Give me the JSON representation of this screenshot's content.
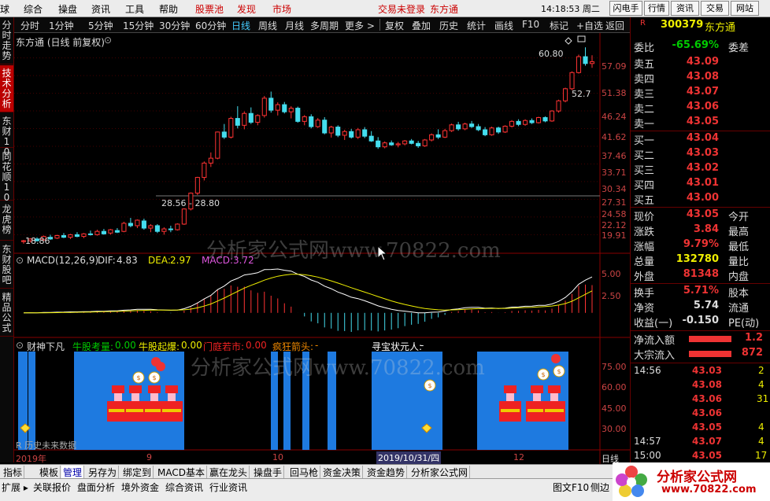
{
  "menubar": {
    "left_cut": "球",
    "items": [
      "综合",
      "操盘",
      "资讯",
      "工具",
      "帮助"
    ],
    "red_items": [
      "股票池",
      "发现",
      "市场"
    ],
    "status": "交易未登录",
    "broker": "东方通",
    "time": "14:18:53 周二",
    "buttons": [
      "闪电手",
      "行情",
      "资讯",
      "交易",
      "网站"
    ]
  },
  "left_tabs": [
    "分时走势",
    "技术分析",
    "东财10",
    "同花顺10",
    "龙虎榜",
    "东财股吧",
    "精品公式"
  ],
  "timeframes": [
    "分时",
    "1分钟",
    "5分钟",
    "15分钟",
    "30分钟",
    "60分钟",
    "日线",
    "周线",
    "月线",
    "多周期",
    "更多 >"
  ],
  "active_timeframe": "日线",
  "tools": [
    "复权",
    "叠加",
    "历史",
    "统计",
    "画线",
    "F10",
    "标记",
    "+自选",
    "返回"
  ],
  "chart_title": "东方通 (日线 前复权)",
  "price_axis": [
    "57.09",
    "51.38",
    "46.24",
    "41.62",
    "37.46",
    "33.71",
    "30.34",
    "27.31",
    "24.58",
    "22.12",
    "19.91"
  ],
  "annotations": {
    "high": "60.80",
    "level": "52.7",
    "range": "28.56 - 28.80",
    "low": "18.86"
  },
  "macd": {
    "name": "MACD(12,26,9)",
    "dif_label": "DIF:",
    "dif": "4.83",
    "dea_label": "DEA:",
    "dea": "2.97",
    "macd_label": "MACD:",
    "macd": "3.72",
    "axis": [
      "5.00",
      "2.50"
    ]
  },
  "ind3": {
    "name": "财神下凡",
    "items": [
      {
        "k": "牛股考量:",
        "v": "0.00",
        "c": "#0c0"
      },
      {
        "k": "牛股起爆:",
        "v": "0.00",
        "c": "#ff0"
      },
      {
        "k": "门庭若市:",
        "v": "0.00",
        "c": "#e22"
      },
      {
        "k": "疯狂箭头:",
        "v": "-",
        "c": "#e80"
      },
      {
        "k": "寻宝状元人:",
        "v": "-",
        "c": "#fff"
      }
    ],
    "axis": [
      "75.00",
      "60.00",
      "45.00",
      "30.00"
    ],
    "note": "R 历史未来数据"
  },
  "date_axis": {
    "labels": [
      "2019年",
      "9",
      "10",
      "2019/10/31/四",
      "12"
    ],
    "period": "日线"
  },
  "watermark": "分析家公式网www.70822.com",
  "quote": {
    "code": "300379",
    "name": "东方通",
    "code_prefix": "R",
    "wb_label": "委比",
    "wb": "-65.69%",
    "wc_label": "委差",
    "asks": [
      {
        "l": "卖五",
        "p": "43.09"
      },
      {
        "l": "卖四",
        "p": "43.08"
      },
      {
        "l": "卖三",
        "p": "43.07"
      },
      {
        "l": "卖二",
        "p": "43.06"
      },
      {
        "l": "卖一",
        "p": "43.05"
      }
    ],
    "bids": [
      {
        "l": "买一",
        "p": "43.04"
      },
      {
        "l": "买二",
        "p": "43.03"
      },
      {
        "l": "买三",
        "p": "43.02"
      },
      {
        "l": "买四",
        "p": "43.01"
      },
      {
        "l": "买五",
        "p": "43.00"
      }
    ],
    "stats": [
      {
        "l": "现价",
        "v": "43.05",
        "r": "今开"
      },
      {
        "l": "涨跌",
        "v": "3.84",
        "r": "最高"
      },
      {
        "l": "涨幅",
        "v": "9.79%",
        "r": "最低"
      },
      {
        "l": "总量",
        "v": "132780",
        "r": "量比"
      },
      {
        "l": "外盘",
        "v": "81348",
        "r": "内盘"
      }
    ],
    "stats2": [
      {
        "l": "换手",
        "v": "5.71%",
        "r": "股本"
      },
      {
        "l": "净资",
        "v": "5.74",
        "r": "流通"
      },
      {
        "l": "收益(一)",
        "v": "-0.150",
        "r": "PE(动)"
      }
    ],
    "flow": [
      {
        "l": "净流入额",
        "v": "1.2"
      },
      {
        "l": "大宗流入",
        "v": "872"
      }
    ],
    "ticks": [
      {
        "t": "14:56",
        "p": "43.03",
        "v": "2"
      },
      {
        "t": "",
        "p": "43.08",
        "v": "4"
      },
      {
        "t": "",
        "p": "43.06",
        "v": "31"
      },
      {
        "t": "",
        "p": "43.06",
        "v": ""
      },
      {
        "t": "",
        "p": "43.05",
        "v": "4"
      },
      {
        "t": "14:57",
        "p": "43.07",
        "v": "4"
      },
      {
        "t": "15:00",
        "p": "43.05",
        "v": "17"
      }
    ]
  },
  "bottom_tabs": [
    "指标",
    "模板",
    "管理",
    "另存为",
    "绑定到",
    "MACD基本",
    "赢在龙头",
    "操盘手",
    "回马枪",
    "资金决策",
    "资金趋势",
    "分析家公式网"
  ],
  "active_bottom_tab": "管理",
  "status_items": [
    "扩展 ▸",
    "关联报价",
    "盘面分析",
    "境外资金",
    "综合资讯",
    "行业资讯"
  ],
  "status_right": [
    "图文F10",
    "侧边"
  ],
  "logo": {
    "text": "分析家公式网",
    "url": "www.70822.com"
  },
  "chart_data": {
    "type": "candlestick",
    "ylim": [
      18.5,
      62
    ],
    "candles": [
      [
        19.1,
        19.3,
        18.86,
        19.2
      ],
      [
        19.2,
        19.5,
        19.0,
        19.4
      ],
      [
        19.4,
        19.6,
        19.1,
        19.2
      ],
      [
        19.3,
        19.8,
        19.2,
        19.7
      ],
      [
        19.6,
        19.9,
        19.3,
        19.4
      ],
      [
        19.5,
        19.9,
        19.4,
        19.8
      ],
      [
        19.8,
        20.1,
        19.5,
        19.6
      ],
      [
        19.6,
        20.0,
        19.4,
        19.9
      ],
      [
        19.9,
        20.2,
        19.6,
        19.7
      ],
      [
        19.7,
        20.1,
        19.5,
        20.0
      ],
      [
        20.0,
        20.4,
        19.8,
        19.9
      ],
      [
        19.9,
        20.5,
        19.8,
        20.3
      ],
      [
        20.3,
        20.6,
        19.9,
        20.0
      ],
      [
        20.1,
        20.6,
        19.9,
        20.5
      ],
      [
        20.4,
        20.7,
        20.1,
        20.2
      ],
      [
        20.3,
        21.5,
        20.2,
        21.3
      ],
      [
        21.3,
        22.0,
        20.8,
        21.0
      ],
      [
        21.0,
        21.8,
        20.7,
        21.7
      ],
      [
        21.6,
        21.9,
        20.5,
        20.7
      ],
      [
        20.7,
        21.2,
        20.2,
        21.0
      ],
      [
        21.0,
        21.2,
        20.1,
        20.3
      ],
      [
        20.3,
        20.8,
        19.9,
        20.6
      ],
      [
        20.6,
        21.0,
        20.2,
        20.5
      ],
      [
        20.5,
        21.3,
        20.4,
        21.2
      ],
      [
        21.2,
        23.3,
        21.1,
        23.2
      ],
      [
        23.2,
        25.6,
        23.0,
        25.5
      ],
      [
        25.5,
        28.1,
        25.2,
        28.0
      ],
      [
        28.0,
        30.8,
        27.5,
        30.5
      ],
      [
        30.5,
        32.5,
        29.8,
        31.4
      ],
      [
        31.4,
        36.8,
        31.2,
        36.7
      ],
      [
        36.7,
        38.5,
        35.2,
        35.6
      ],
      [
        35.6,
        40.2,
        35.3,
        39.8
      ],
      [
        39.8,
        42.8,
        37.5,
        38.2
      ],
      [
        38.2,
        41.5,
        37.3,
        41.0
      ],
      [
        41.0,
        42.5,
        38.5,
        38.9
      ],
      [
        38.9,
        40.8,
        38.2,
        40.5
      ],
      [
        40.5,
        45.5,
        40.0,
        44.9
      ],
      [
        44.9,
        46.7,
        41.2,
        41.8
      ],
      [
        41.8,
        43.8,
        40.5,
        43.2
      ],
      [
        43.2,
        43.9,
        41.0,
        41.4
      ],
      [
        41.4,
        42.8,
        39.8,
        42.3
      ],
      [
        42.3,
        42.7,
        38.8,
        39.1
      ],
      [
        39.1,
        40.6,
        38.2,
        40.2
      ],
      [
        40.2,
        40.8,
        37.5,
        37.9
      ],
      [
        37.9,
        39.9,
        37.6,
        39.4
      ],
      [
        39.4,
        40.1,
        36.2,
        36.5
      ],
      [
        36.5,
        38.1,
        35.5,
        37.8
      ],
      [
        37.8,
        38.2,
        35.6,
        36.0
      ],
      [
        36.0,
        37.2,
        35.0,
        36.8
      ],
      [
        36.8,
        37.4,
        35.3,
        35.6
      ],
      [
        35.6,
        37.6,
        35.2,
        37.2
      ],
      [
        37.2,
        37.8,
        35.4,
        35.8
      ],
      [
        35.8,
        36.9,
        34.6,
        34.8
      ],
      [
        34.8,
        35.6,
        33.2,
        33.6
      ],
      [
        33.6,
        34.7,
        33.3,
        34.4
      ],
      [
        34.4,
        34.9,
        33.8,
        34.0
      ],
      [
        34.0,
        34.6,
        33.5,
        34.2
      ],
      [
        34.2,
        35.0,
        33.9,
        34.8
      ],
      [
        34.8,
        35.2,
        34.1,
        34.3
      ],
      [
        34.3,
        34.8,
        33.4,
        33.8
      ],
      [
        33.8,
        35.2,
        33.6,
        35.0
      ],
      [
        35.0,
        36.4,
        34.7,
        36.1
      ],
      [
        36.1,
        37.3,
        35.2,
        35.6
      ],
      [
        35.6,
        37.4,
        35.4,
        37.0
      ],
      [
        37.0,
        38.6,
        36.7,
        38.3
      ],
      [
        38.3,
        39.0,
        37.0,
        37.4
      ],
      [
        37.4,
        38.8,
        37.1,
        38.5
      ],
      [
        38.5,
        39.2,
        37.6,
        37.9
      ],
      [
        37.9,
        38.5,
        36.9,
        37.2
      ],
      [
        37.2,
        37.8,
        35.8,
        36.1
      ],
      [
        36.1,
        37.9,
        35.9,
        37.6
      ],
      [
        37.6,
        37.9,
        36.3,
        36.7
      ],
      [
        36.7,
        38.2,
        36.5,
        38.0
      ],
      [
        38.0,
        39.4,
        37.7,
        39.1
      ],
      [
        39.1,
        39.6,
        38.0,
        38.4
      ],
      [
        38.4,
        39.6,
        38.1,
        39.3
      ],
      [
        39.3,
        39.8,
        38.5,
        38.8
      ],
      [
        38.8,
        40.2,
        38.6,
        40.0
      ],
      [
        40.0,
        40.3,
        38.9,
        39.2
      ],
      [
        39.2,
        41.8,
        39.0,
        41.6
      ],
      [
        41.6,
        44.5,
        41.2,
        44.2
      ],
      [
        44.2,
        47.8,
        43.8,
        47.5
      ],
      [
        47.5,
        52.7,
        47.1,
        52.3
      ],
      [
        52.3,
        58.2,
        52.0,
        57.5
      ],
      [
        57.5,
        60.8,
        54.5,
        55.2
      ],
      [
        55.2,
        58.0,
        53.8,
        55.8
      ]
    ]
  }
}
